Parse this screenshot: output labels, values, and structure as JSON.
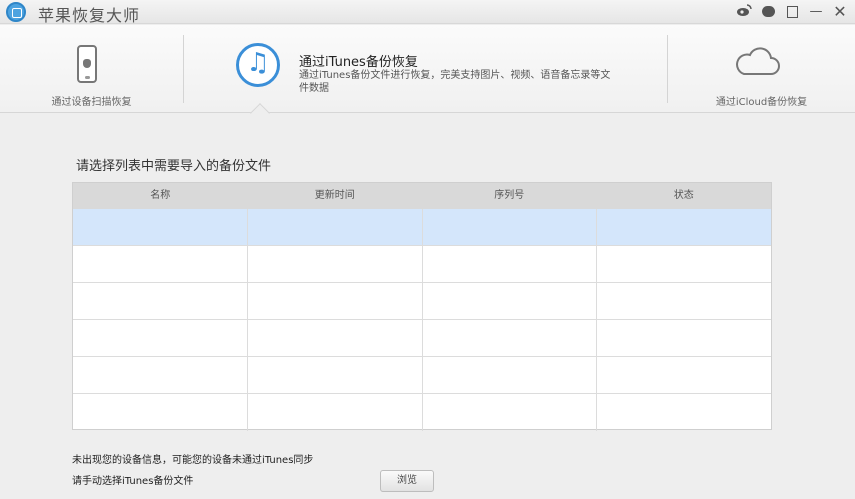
{
  "app": {
    "title": "苹果恢复大师"
  },
  "window_controls": {
    "weibo_icon": "weibo-icon",
    "chat_icon": "chat-icon",
    "feedback_icon": "feedback-icon",
    "minimize_glyph": "—",
    "close_glyph": "✕"
  },
  "modes": {
    "device": {
      "label": "通过设备扫描恢复",
      "icon": "phone-icon"
    },
    "itunes": {
      "title": "通过iTunes备份恢复",
      "description": "通过iTunes备份文件进行恢复，完美支持图片、视频、语音备忘录等文件数据",
      "icon": "music-note-icon",
      "note_glyph": "♫"
    },
    "icloud": {
      "label": "通过iCloud备份恢复",
      "icon": "cloud-icon"
    }
  },
  "main": {
    "section_title": "请选择列表中需要导入的备份文件",
    "table": {
      "columns": [
        "名称",
        "更新时间",
        "序列号",
        "状态"
      ],
      "selected_row": 0
    },
    "notice": "未出现您的设备信息，可能您的设备未通过iTunes同步",
    "manual_hint": "请手动选择iTunes备份文件",
    "browse_label": "浏览"
  },
  "colors": {
    "accent": "#3b8fd8",
    "selected_row": "#d4e6fb",
    "header_bg": "#d9d9d9",
    "background": "#eeeeee"
  }
}
